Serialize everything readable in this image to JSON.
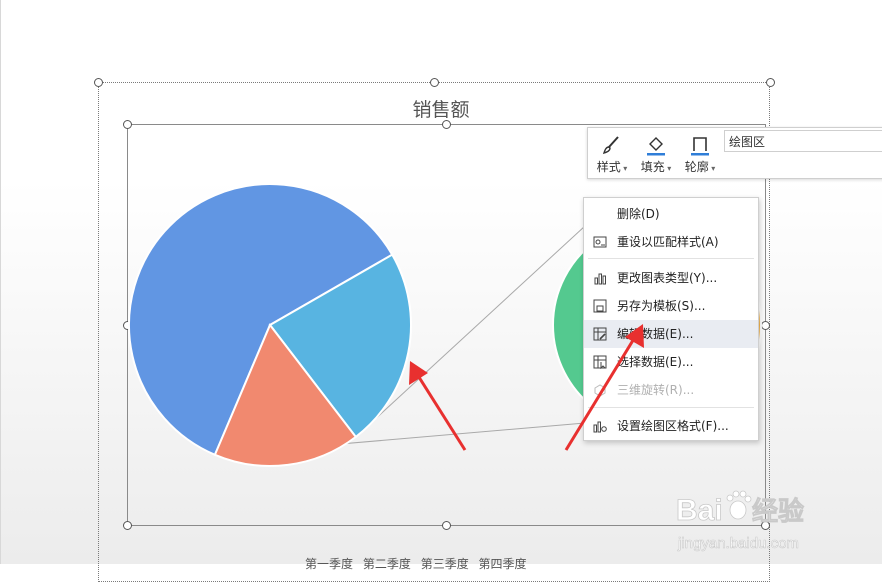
{
  "chart": {
    "title": "销售额",
    "legend": [
      "第一季度",
      "第二季度",
      "第三季度",
      "第四季度"
    ]
  },
  "chart_data": {
    "type": "pie",
    "title": "销售额",
    "note": "bar-of-pie / pie-of-pie layout; secondary pie partially hidden by menu",
    "slices": [
      {
        "label": "",
        "value": 60.3,
        "color": "#6196e3"
      },
      {
        "label": "",
        "value": 22.9,
        "color": "#58b4e1"
      },
      {
        "label": "",
        "value": 16.8,
        "color": "#f1896f"
      }
    ],
    "secondary_pie_colors": [
      "#54c98f",
      "#f7b74d"
    ],
    "legend": [
      "第一季度",
      "第二季度",
      "第三季度",
      "第四季度"
    ]
  },
  "toolbar": {
    "style_label": "样式",
    "fill_label": "填充",
    "outline_label": "轮廓",
    "element_select": "绘图区"
  },
  "menu": {
    "items": [
      {
        "label": "删除(D)",
        "icon": "none",
        "state": "normal"
      },
      {
        "label": "重设以匹配样式(A)",
        "icon": "reset-style-icon",
        "state": "normal"
      },
      {
        "label": "更改图表类型(Y)...",
        "icon": "chart-type-icon",
        "state": "normal"
      },
      {
        "label": "另存为模板(S)...",
        "icon": "save-template-icon",
        "state": "normal"
      },
      {
        "label": "编辑数据(E)...",
        "icon": "edit-data-icon",
        "state": "highlighted"
      },
      {
        "label": "选择数据(E)...",
        "icon": "select-data-icon",
        "state": "normal"
      },
      {
        "label": "三维旋转(R)...",
        "icon": "rotate-3d-icon",
        "state": "disabled"
      },
      {
        "label": "设置绘图区格式(F)...",
        "icon": "format-plot-icon",
        "state": "normal"
      }
    ]
  },
  "watermark": {
    "brand": "Baidu",
    "brand_cn": "经验",
    "url": "jingyan.baidu.com"
  },
  "annotations": {
    "arrow_color": "#e8302f"
  }
}
